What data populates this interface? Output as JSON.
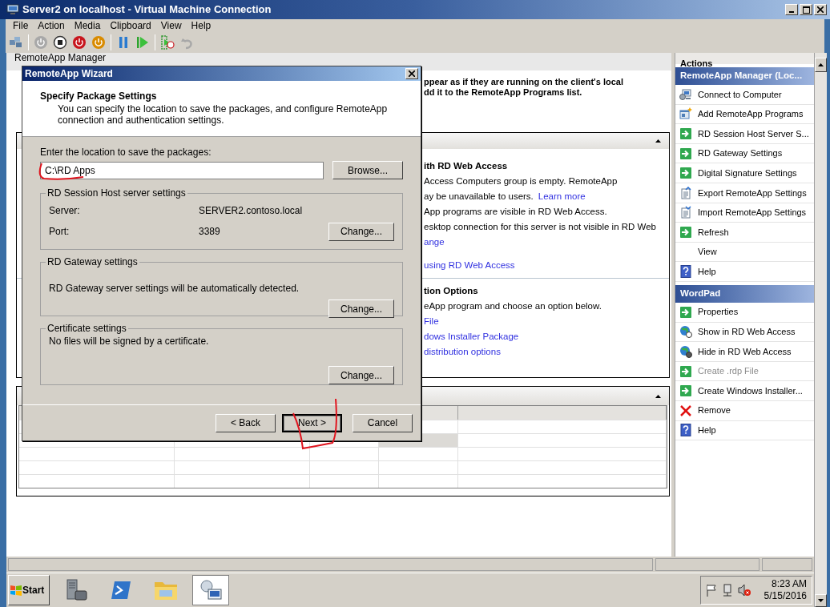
{
  "window": {
    "title": "Server2 on localhost - Virtual Machine Connection"
  },
  "menu": [
    "File",
    "Action",
    "Media",
    "Clipboard",
    "View",
    "Help"
  ],
  "toolbar": [
    [
      {
        "kind": "ctrl-alt-del",
        "disabled": false
      }
    ],
    [
      {
        "kind": "start",
        "disabled": true
      },
      {
        "kind": "turn-off",
        "disabled": false
      },
      {
        "kind": "shut-down",
        "disabled": false
      },
      {
        "kind": "save",
        "disabled": false
      }
    ],
    [
      {
        "kind": "pause",
        "disabled": false
      },
      {
        "kind": "reset",
        "disabled": false
      }
    ],
    [
      {
        "kind": "checkpoint",
        "disabled": false
      },
      {
        "kind": "revert",
        "disabled": true
      }
    ]
  ],
  "main": {
    "title": "RemoteApp Manager",
    "intro": [
      "ppear as if they are running on the client's local",
      "dd it to the RemoteApp Programs list."
    ],
    "sections": [
      [
        {
          "kind": "heading",
          "text": "ith RD Web Access"
        },
        {
          "kind": "text",
          "text": "Access Computers group is empty. RemoteApp"
        },
        {
          "kind": "text",
          "text": "ay be unavailable to users.",
          "link": "Learn more"
        },
        {
          "kind": "text",
          "text": "App programs are visible in RD Web Access."
        },
        {
          "kind": "text",
          "text": "esktop connection for this server is not visible in RD Web"
        },
        {
          "kind": "link",
          "text": "ange"
        },
        {
          "kind": "link",
          "text": "using RD Web Access"
        }
      ],
      [
        {
          "kind": "heading",
          "text": "tion Options"
        },
        {
          "kind": "text",
          "text": "eApp program and choose an option below."
        },
        {
          "kind": "link",
          "text": "File"
        },
        {
          "kind": "link",
          "text": "dows Installer Package"
        },
        {
          "kind": "link",
          "text": "distribution options"
        }
      ]
    ],
    "table_rows": [
      {
        "selected": false
      },
      {
        "selected": true
      },
      {
        "selected": false
      },
      {
        "selected": false
      },
      {
        "selected": false
      }
    ]
  },
  "actions": {
    "title": "Actions",
    "groups": [
      {
        "title": "RemoteApp Manager (Loc...",
        "items": [
          {
            "label": "Connect to Computer",
            "kind": "connect",
            "disabled": false
          },
          {
            "label": "Add RemoteApp Programs",
            "kind": "add",
            "disabled": false
          },
          {
            "label": "RD Session Host Server S...",
            "kind": "arrow",
            "disabled": false
          },
          {
            "label": "RD Gateway Settings",
            "kind": "arrow",
            "disabled": false
          },
          {
            "label": "Digital Signature Settings",
            "kind": "arrow",
            "disabled": false
          },
          {
            "label": "Export RemoteApp Settings",
            "kind": "export",
            "disabled": false
          },
          {
            "label": "Import RemoteApp Settings",
            "kind": "import",
            "disabled": false
          },
          {
            "label": "Refresh",
            "kind": "arrow",
            "disabled": false
          },
          {
            "label": "View",
            "kind": "none",
            "disabled": false
          },
          {
            "label": "Help",
            "kind": "help",
            "disabled": false
          }
        ]
      },
      {
        "title": "WordPad",
        "items": [
          {
            "label": "Properties",
            "kind": "arrow",
            "disabled": false
          },
          {
            "label": "Show in RD Web Access",
            "kind": "show-web",
            "disabled": false
          },
          {
            "label": "Hide in RD Web Access",
            "kind": "hide-web",
            "disabled": false
          },
          {
            "label": "Create .rdp File",
            "kind": "arrow",
            "disabled": true
          },
          {
            "label": "Create Windows Installer...",
            "kind": "arrow",
            "disabled": false
          },
          {
            "label": "Remove",
            "kind": "remove",
            "disabled": false
          },
          {
            "label": "Help",
            "kind": "help",
            "disabled": false
          }
        ]
      }
    ]
  },
  "dialog": {
    "title": "RemoteApp Wizard",
    "heading": "Specify Package Settings",
    "description": "You can specify the location to save the packages, and configure RemoteApp connection and authentication settings.",
    "location_label": "Enter the location to save the packages:",
    "location_value": "C:\\RD Apps",
    "browse_button": "Browse...",
    "groups": [
      {
        "title": "RD Session Host server settings",
        "rows": [
          {
            "label": "Server:",
            "value": "SERVER2.contoso.local"
          },
          {
            "label": "Port:",
            "value": "3389"
          }
        ],
        "button": "Change..."
      },
      {
        "title": "RD Gateway settings",
        "text": "RD Gateway server settings will be automatically detected.",
        "button": "Change..."
      },
      {
        "title": "Certificate settings",
        "text": "No files will be signed by a certificate.",
        "button": "Change..."
      }
    ],
    "buttons": [
      {
        "label": "< Back",
        "default": false
      },
      {
        "label": "Next >",
        "default": true
      },
      {
        "label": "Cancel",
        "default": false
      }
    ]
  },
  "taskbar": {
    "start": "Start",
    "apps": [
      {
        "kind": "server-manager",
        "selected": false
      },
      {
        "kind": "powershell",
        "selected": false
      },
      {
        "kind": "explorer",
        "selected": false
      },
      {
        "kind": "remoteapp",
        "selected": true
      }
    ],
    "time": "8:23 AM",
    "date": "5/15/2016"
  }
}
